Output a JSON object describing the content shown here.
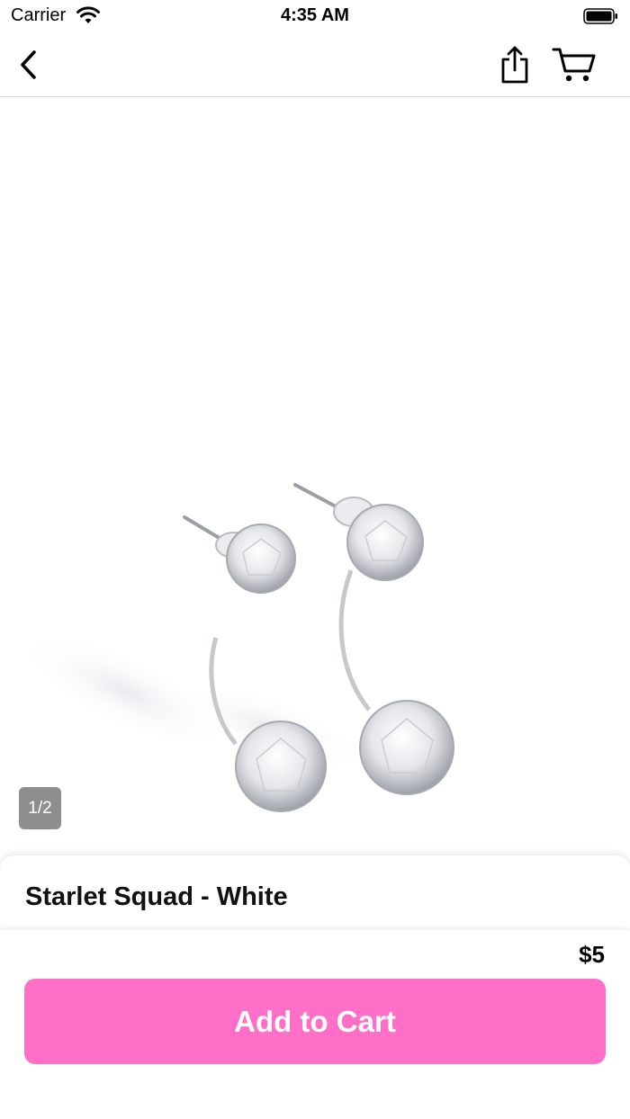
{
  "status_bar": {
    "carrier": "Carrier",
    "time": "4:35 AM",
    "wifi_icon": "wifi-icon",
    "battery_icon": "battery-icon"
  },
  "nav": {
    "back_icon": "chevron-left-icon",
    "share_icon": "share-icon",
    "cart_icon": "cart-icon"
  },
  "gallery": {
    "counter": "1/2",
    "image": "crystal-drop-earrings-photo"
  },
  "product": {
    "title": "Starlet Squad - White",
    "price": "$5"
  },
  "actions": {
    "add_to_cart_label": "Add to Cart"
  },
  "colors": {
    "accent": "#ff6fc8",
    "counter_bg": "#8e8e8e"
  }
}
